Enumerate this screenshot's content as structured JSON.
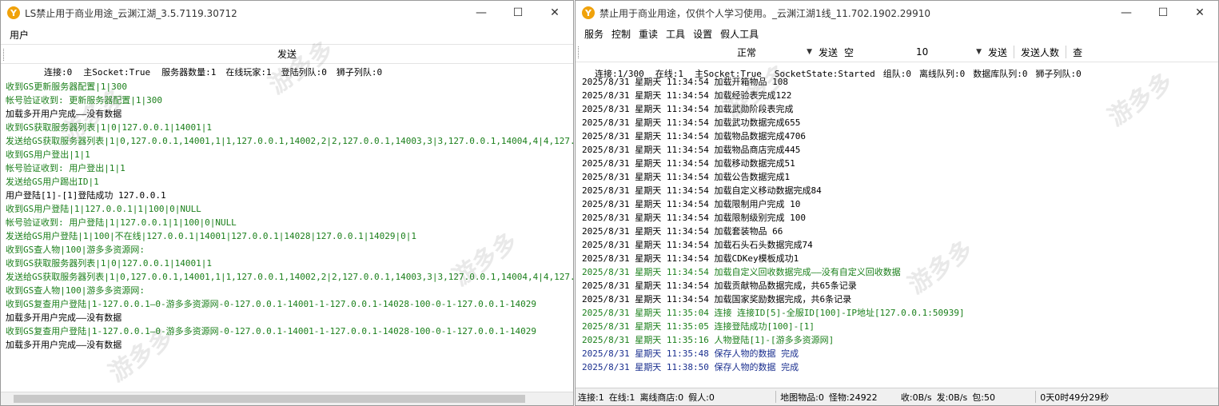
{
  "window1": {
    "title": "LS禁止用于商业用途_云渊江湖_3.5.7119.30712",
    "menu": [
      "用户"
    ],
    "send_label": "发送",
    "status": {
      "conn": "连接:0",
      "socket": "主Socket:True",
      "servers": "服务器数量:1",
      "online": "在线玩家:1",
      "queue": "登陆列队:0",
      "lion": "狮子列队:0"
    },
    "log": [
      {
        "text": "收到GS更新服务器配置|1|300",
        "color": "green"
      },
      {
        "text": "帐号验证收到: 更新服务器配置|1|300",
        "color": "green"
      },
      {
        "text": "加载多开用户完成——没有数据",
        "color": "black"
      },
      {
        "text": "收到GS获取服务器列表|1|0|127.0.0.1|14001|1",
        "color": "green"
      },
      {
        "text": "发送给GS获取服务器列表|1|0,127.0.0.1,14001,1|1,127.0.0.1,14002,2|2,127.0.0.1,14003,3|3,127.0.0.1,14004,4|4,127.0",
        "color": "green"
      },
      {
        "text": "收到GS用户登出|1|1",
        "color": "green"
      },
      {
        "text": "帐号验证收到: 用户登出|1|1",
        "color": "green"
      },
      {
        "text": "发送给GS用户踢出ID|1",
        "color": "green"
      },
      {
        "text": "用户登陆[1]-[1]登陆成功  127.0.0.1",
        "color": "black"
      },
      {
        "text": "收到GS用户登陆|1|127.0.0.1|1|100|0|NULL",
        "color": "green"
      },
      {
        "text": "帐号验证收到: 用户登陆|1|127.0.0.1|1|100|0|NULL",
        "color": "green"
      },
      {
        "text": "发送给GS用户登陆|1|100|不在线|127.0.0.1|14001|127.0.0.1|14028|127.0.0.1|14029|0|1",
        "color": "green"
      },
      {
        "text": "收到GS查人物|100|游多多资源网:",
        "color": "green"
      },
      {
        "text": "收到GS获取服务器列表|1|0|127.0.0.1|14001|1",
        "color": "green"
      },
      {
        "text": "发送给GS获取服务器列表|1|0,127.0.0.1,14001,1|1,127.0.0.1,14002,2|2,127.0.0.1,14003,3|3,127.0.0.1,14004,4|4,127.0",
        "color": "green"
      },
      {
        "text": "收到GS查人物|100|游多多资源网:",
        "color": "green"
      },
      {
        "text": "收到GS复查用户登陆|1-127.0.0.1—0-游多多资源网-0-127.0.0.1-14001-1-127.0.0.1-14028-100-0-1-127.0.0.1-14029",
        "color": "green"
      },
      {
        "text": "加载多开用户完成——没有数据",
        "color": "black"
      },
      {
        "text": "收到GS复查用户登陆|1-127.0.0.1—0-游多多资源网-0-127.0.0.1-14001-1-127.0.0.1-14028-100-0-1-127.0.0.1-14029",
        "color": "green"
      },
      {
        "text": "加载多开用户完成——没有数据",
        "color": "black"
      }
    ]
  },
  "window2": {
    "title": "禁止用于商业用途，仅供个人学习使用。_云渊江湖1线_11.702.1902.29910",
    "menu": [
      "服务",
      "控制",
      "重读",
      "工具",
      "设置",
      "假人工具"
    ],
    "toolbar": {
      "mode_value": "正常",
      "send1": "发送",
      "empty_label": "空",
      "count_value": "10",
      "send2": "发送",
      "send_count": "发送人数",
      "query": "查"
    },
    "status": {
      "conn": "连接:1/300",
      "online": "在线:1",
      "socket": "主Socket:True",
      "state": "SocketState:Started",
      "team": "组队:0",
      "offline_queue": "离线队列:0",
      "db_queue": "数据库队列:0",
      "lion": "狮子列队:0"
    },
    "log": [
      {
        "text": "2025/8/31 星期天 11:34:54 加载开箱物品  108",
        "color": "black"
      },
      {
        "text": "2025/8/31 星期天 11:34:54 加载经验表完成122",
        "color": "black"
      },
      {
        "text": "2025/8/31 星期天 11:34:54 加载武勋阶段表完成",
        "color": "black"
      },
      {
        "text": "2025/8/31 星期天 11:34:54 加载武功数据完成655",
        "color": "black"
      },
      {
        "text": "2025/8/31 星期天 11:34:54 加载物品数据完成4706",
        "color": "black"
      },
      {
        "text": "2025/8/31 星期天 11:34:54 加载物品商店完成445",
        "color": "black"
      },
      {
        "text": "2025/8/31 星期天 11:34:54 加载移动数据完成51",
        "color": "black"
      },
      {
        "text": "2025/8/31 星期天 11:34:54 加载公告数据完成1",
        "color": "black"
      },
      {
        "text": "2025/8/31 星期天 11:34:54 加载自定义移动数据完成84",
        "color": "black"
      },
      {
        "text": "2025/8/31 星期天 11:34:54 加载限制用户完成   10",
        "color": "black"
      },
      {
        "text": "2025/8/31 星期天 11:34:54 加载限制级别完成   100",
        "color": "black"
      },
      {
        "text": "2025/8/31 星期天 11:34:54 加载套装物品   66",
        "color": "black"
      },
      {
        "text": "2025/8/31 星期天 11:34:54 加载石头石头数据完成74",
        "color": "black"
      },
      {
        "text": "2025/8/31 星期天  11:34:54 加载CDKey模板成功1",
        "color": "black"
      },
      {
        "text": "2025/8/31 星期天 11:34:54 加载自定义回收数据完成——没有自定义回收数据",
        "color": "green"
      },
      {
        "text": "2025/8/31 星期天 11:34:54 加载贡献物品数据完成，共65条记录",
        "color": "black"
      },
      {
        "text": "2025/8/31 星期天 11:34:54 加载国家奖励数据完成，共6条记录",
        "color": "black"
      },
      {
        "text": "2025/8/31 星期天 11:35:04 连接 连接ID[5]-全服ID[100]-IP地址[127.0.0.1:50939]",
        "color": "green"
      },
      {
        "text": "2025/8/31 星期天 11:35:05 连接登陆成功[100]-[1]",
        "color": "green"
      },
      {
        "text": "2025/8/31 星期天 11:35:16 人物登陆[1]-[游多多资源网]",
        "color": "green"
      },
      {
        "text": "2025/8/31 星期天 11:35:48 保存人物的数据  完成",
        "color": "blue"
      },
      {
        "text": "2025/8/31 星期天 11:38:50 保存人物的数据  完成",
        "color": "blue"
      }
    ],
    "statusbar": {
      "conn": "连接:1",
      "online": "在线:1",
      "offline_shop": "离线商店:0",
      "bots": "假人:0",
      "map_items": "地图物品:0",
      "monsters": "怪物:24922",
      "recv": "收:0B/s",
      "send": "发:0B/s",
      "packets": "包:50",
      "uptime": "0天0时49分29秒"
    }
  },
  "watermark": {
    "text": "游多多",
    "sub": "Youdd.Net"
  },
  "colors": {
    "green": "#1a7f1a",
    "blue": "#1a2f8f",
    "icon": "#f0a20b"
  }
}
